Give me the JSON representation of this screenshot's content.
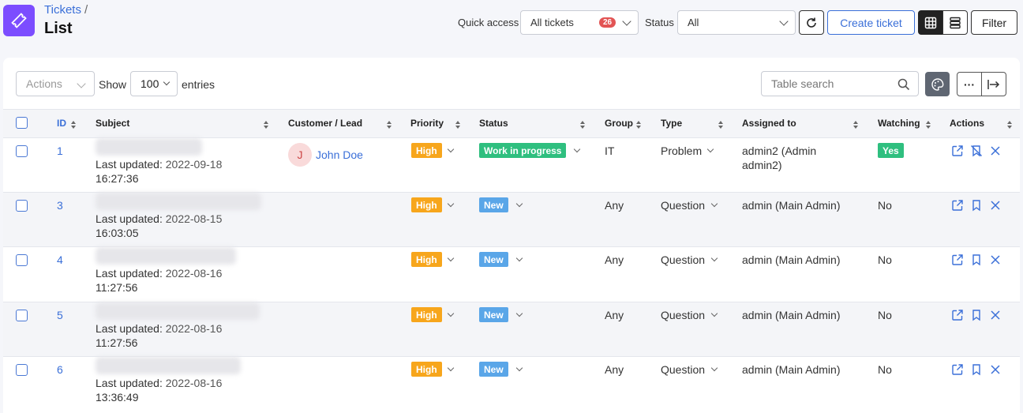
{
  "header": {
    "breadcrumb": "Tickets",
    "breadcrumb_sep": "/",
    "title": "List",
    "quick_access_label": "Quick access",
    "quick_access_value": "All tickets",
    "quick_access_count": "26",
    "status_label": "Status",
    "status_value": "All",
    "create_label": "Create ticket",
    "filter_label": "Filter"
  },
  "toolbar": {
    "actions_label": "Actions",
    "show_label": "Show",
    "entries_value": "100",
    "entries_label": "entries",
    "search_placeholder": "Table search",
    "more_label": "···"
  },
  "table": {
    "columns": [
      "ID",
      "Subject",
      "Customer / Lead",
      "Priority",
      "Status",
      "Group",
      "Type",
      "Assigned to",
      "Watching",
      "Actions"
    ],
    "rows": [
      {
        "id": "1",
        "updated_label": "Last updated:",
        "updated_date": "2022-09-18",
        "updated_time": "16:27:36",
        "customer_initial": "J",
        "customer": "John Doe",
        "priority": "High",
        "status": "Work in progress",
        "group": "IT",
        "type": "Problem",
        "assigned_1": "admin2 (Admin",
        "assigned_2": "admin2)",
        "watching": "Yes"
      },
      {
        "id": "3",
        "updated_label": "Last updated:",
        "updated_date": "2022-08-15",
        "updated_time": "16:03:05",
        "customer_initial": "",
        "customer": "",
        "priority": "High",
        "status": "New",
        "group": "Any",
        "type": "Question",
        "assigned_1": "admin (Main Admin)",
        "assigned_2": "",
        "watching": "No"
      },
      {
        "id": "4",
        "updated_label": "Last updated:",
        "updated_date": "2022-08-16",
        "updated_time": "11:27:56",
        "customer_initial": "",
        "customer": "",
        "priority": "High",
        "status": "New",
        "group": "Any",
        "type": "Question",
        "assigned_1": "admin (Main Admin)",
        "assigned_2": "",
        "watching": "No"
      },
      {
        "id": "5",
        "updated_label": "Last updated:",
        "updated_date": "2022-08-16",
        "updated_time": "11:27:56",
        "customer_initial": "",
        "customer": "",
        "priority": "High",
        "status": "New",
        "group": "Any",
        "type": "Question",
        "assigned_1": "admin (Main Admin)",
        "assigned_2": "",
        "watching": "No"
      },
      {
        "id": "6",
        "updated_label": "Last updated:",
        "updated_date": "2022-08-16",
        "updated_time": "13:36:49",
        "customer_initial": "",
        "customer": "",
        "priority": "High",
        "status": "New",
        "group": "Any",
        "type": "Question",
        "assigned_1": "admin (Main Admin)",
        "assigned_2": "",
        "watching": "No"
      }
    ]
  },
  "colors": {
    "brand": "#7c4dff",
    "link": "#3a6fd8",
    "priority_high": "#f7a61c",
    "status_wip": "#2fbf7f",
    "status_new": "#5aa6e8",
    "watching_yes": "#2fbf7f",
    "count_badge": "#e25454"
  },
  "icons": [
    "ticket-icon",
    "refresh-icon",
    "grid-view-icon",
    "list-view-icon",
    "search-icon",
    "palette-icon",
    "more-icon",
    "export-icon",
    "open-icon",
    "bookmark-icon",
    "unwatch-icon",
    "delete-icon"
  ]
}
